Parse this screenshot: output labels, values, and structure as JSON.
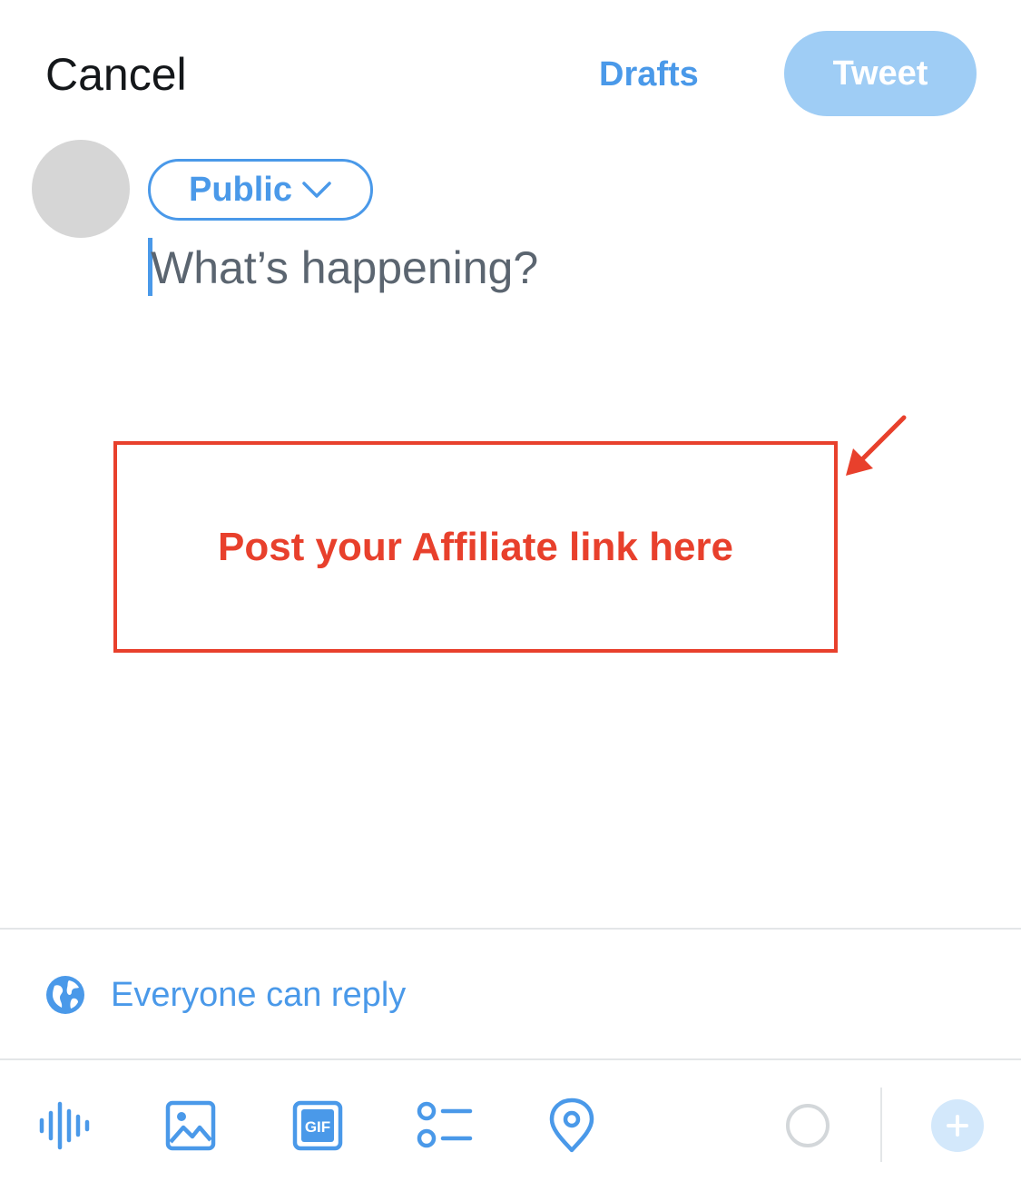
{
  "header": {
    "cancel_label": "Cancel",
    "drafts_label": "Drafts",
    "tweet_label": "Tweet"
  },
  "composer": {
    "audience_label": "Public",
    "placeholder": "What’s happening?"
  },
  "annotation": {
    "text": "Post your Affiliate link here",
    "color": "#e8402c"
  },
  "reply_settings": {
    "label": "Everyone can reply",
    "icon": "globe-icon"
  },
  "toolbar": {
    "icons": [
      "voice-icon",
      "image-icon",
      "gif-icon",
      "poll-icon",
      "location-icon",
      "character-count-ring",
      "add-thread-icon"
    ]
  },
  "colors": {
    "accent": "#4a99e9",
    "tweet_disabled": "#9fcdf5",
    "annotation": "#e8402c"
  }
}
